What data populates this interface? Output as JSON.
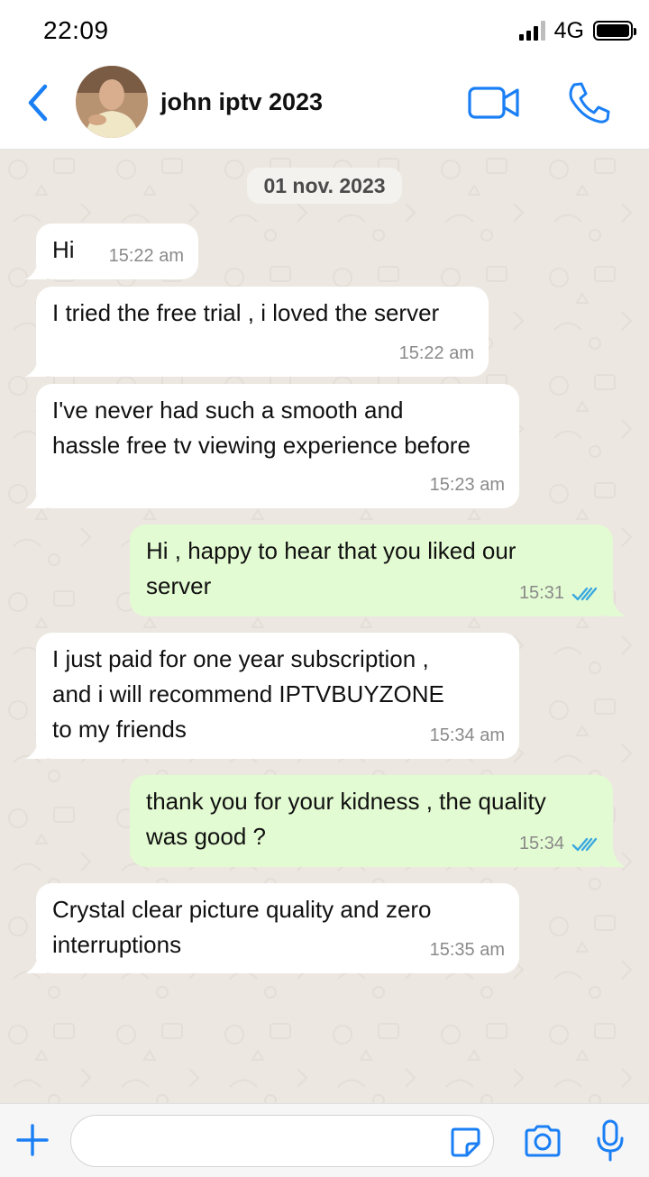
{
  "status_bar": {
    "time": "22:09",
    "network": "4G"
  },
  "header": {
    "contact_name": "john iptv 2023"
  },
  "chat": {
    "date_label": "01 nov. 2023",
    "messages": [
      {
        "direction": "in",
        "text": "Hi",
        "time": "15:22 am"
      },
      {
        "direction": "in",
        "text": "I tried the free trial , i loved the server",
        "time": "15:22 am"
      },
      {
        "direction": "in",
        "text": "I've never had such a smooth and\nhassle free tv viewing experience before",
        "time": "15:23 am"
      },
      {
        "direction": "out",
        "text": "Hi , happy to hear that you liked our\nserver",
        "time": "15:31",
        "status": "read"
      },
      {
        "direction": "in",
        "text": "I just paid for one year subscription ,\nand i will recommend IPTVBUYZONE\nto my friends",
        "time": "15:34 am"
      },
      {
        "direction": "out",
        "text": "thank you for your kidness , the quality\nwas good ?",
        "time": "15:34",
        "status": "read"
      },
      {
        "direction": "in",
        "text": "Crystal clear picture quality and zero\ninterruptions",
        "time": "15:35 am"
      }
    ]
  },
  "input_bar": {
    "placeholder": ""
  },
  "colors": {
    "accent": "#1a7ff5",
    "incoming_bubble": "#ffffff",
    "outgoing_bubble": "#e3fbd2",
    "chat_background": "#ece8e1",
    "read_ticks": "#3aa8e0"
  },
  "icons": {
    "back": "chevron-left-icon",
    "video": "video-camera-icon",
    "call": "phone-icon",
    "attach": "plus-icon",
    "sticker": "sticker-icon",
    "camera": "camera-icon",
    "mic": "microphone-icon"
  }
}
